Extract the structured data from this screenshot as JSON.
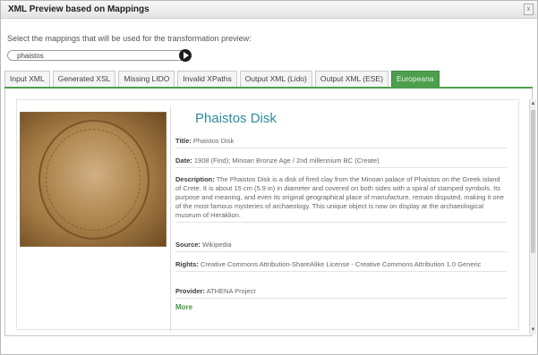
{
  "window": {
    "title": "XML Preview based on Mappings",
    "close_label": "x"
  },
  "toolbar": {
    "instruction": "Select the mappings that will be used for the transformation preview:",
    "search_value": "phaistos"
  },
  "tabs": [
    {
      "label": "Input XML"
    },
    {
      "label": "Generated XSL"
    },
    {
      "label": "Missing LIDO"
    },
    {
      "label": "Invalid XPaths"
    },
    {
      "label": "Output XML (Lido)"
    },
    {
      "label": "Output XML (ESE)"
    },
    {
      "label": "Europeana"
    }
  ],
  "record": {
    "title": "Phaistos Disk",
    "fields": [
      {
        "label": "Title:",
        "value": "Phaistos Disk"
      },
      {
        "label": "Date:",
        "value": "1908 (Find); Minoan Bronze Age / 2nd millennium BC (Create)"
      },
      {
        "label": "Description:",
        "value": "The Phaistos Disk is a disk of fired clay from the Minoan palace of Phaistos on the Greek island of Crete. It is about 15 cm (5.9 in) in diameter and covered on both sides with a spiral of stamped symbols. Its purpose and meaning, and even its original geographical place of manufacture, remain disputed, making it one of the most famous mysteries of archaeology. This unique object is now on display at the archaeological museum of Heraklion."
      },
      {
        "label": "Source:",
        "value": "Wikipedia"
      },
      {
        "label": "Rights:",
        "value": "Creative Commons Attribution-ShareAlike License - Creative Commons Attribution 1.0 Generic"
      },
      {
        "label": "Provider:",
        "value": "ATHENA Project"
      }
    ],
    "more_label": "More"
  },
  "colors": {
    "accent": "#4d9f4d",
    "title_teal": "#2d8d9a"
  },
  "icons": {
    "go": "play-arrow-icon",
    "close": "close-icon"
  }
}
